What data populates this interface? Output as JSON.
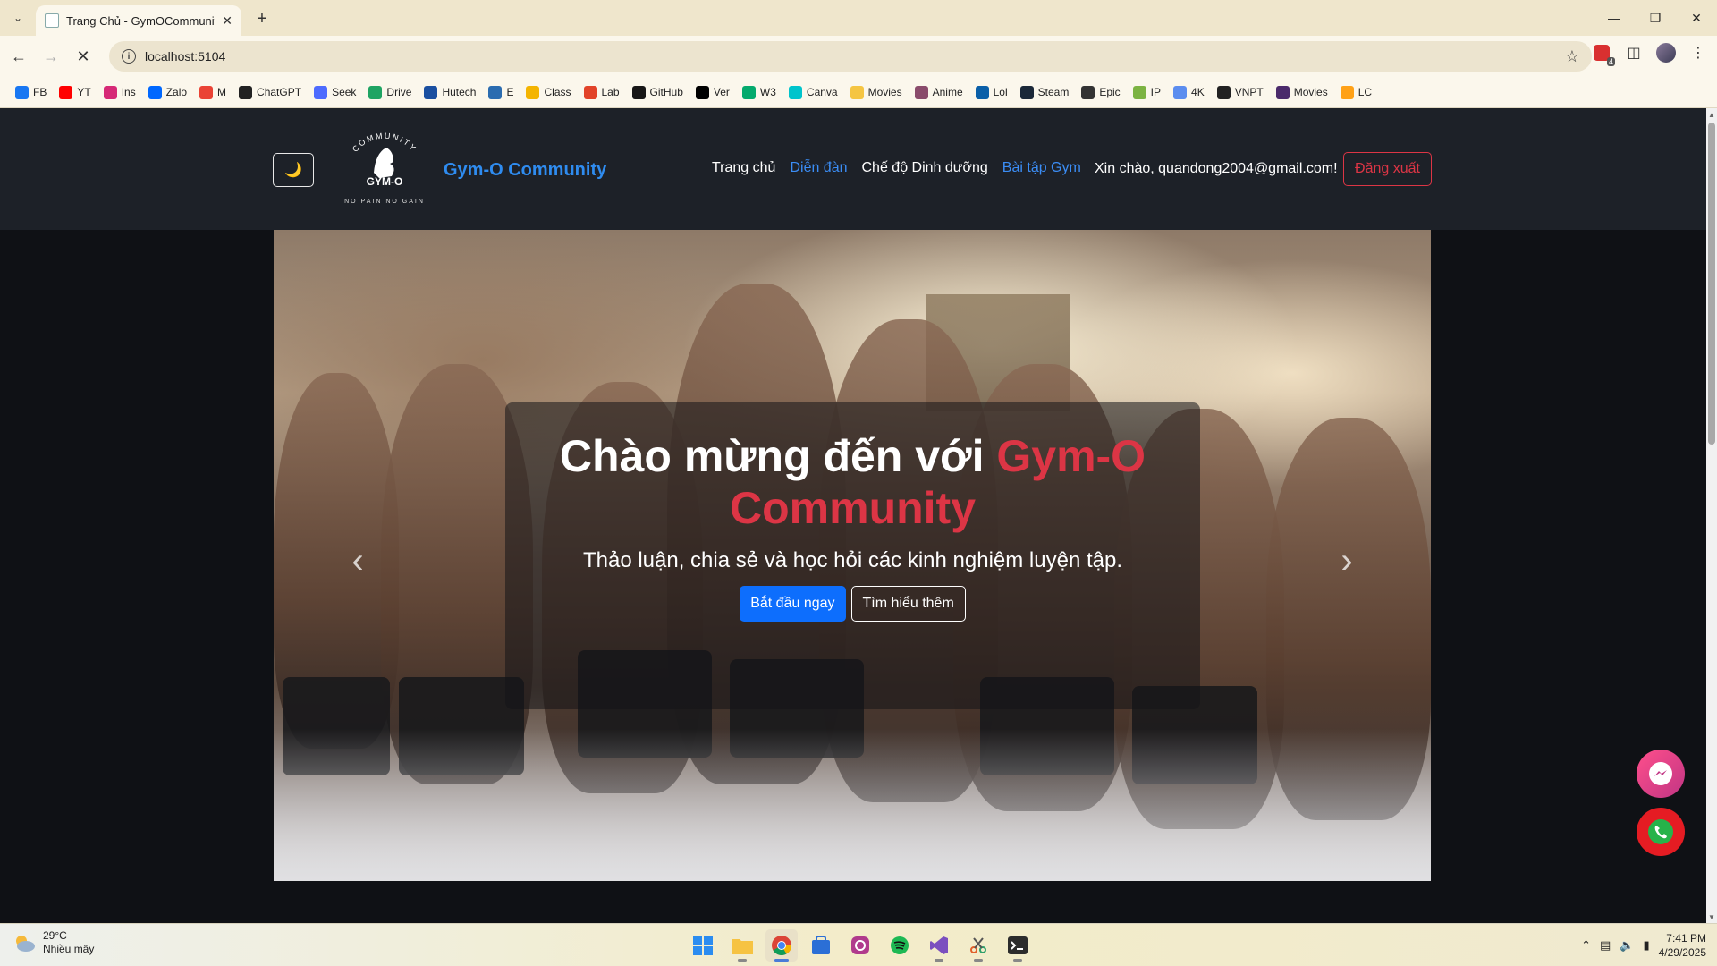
{
  "browser": {
    "tab_title": "Trang Chủ - GymOCommunity",
    "url": "localhost:5104",
    "bookmarks": [
      {
        "label": "FB",
        "color": "#1877f2"
      },
      {
        "label": "YT",
        "color": "#ff0000"
      },
      {
        "label": "Ins",
        "color": "#d62976"
      },
      {
        "label": "Zalo",
        "color": "#0068ff"
      },
      {
        "label": "M",
        "color": "#ea4335"
      },
      {
        "label": "ChatGPT",
        "color": "#222222"
      },
      {
        "label": "Seek",
        "color": "#4d6bfe"
      },
      {
        "label": "Drive",
        "color": "#1fa463"
      },
      {
        "label": "Hutech",
        "color": "#1a4fa0"
      },
      {
        "label": "E",
        "color": "#2b6cb0"
      },
      {
        "label": "Class",
        "color": "#f4b400"
      },
      {
        "label": "Lab",
        "color": "#e24329"
      },
      {
        "label": "GitHub",
        "color": "#181717"
      },
      {
        "label": "Ver",
        "color": "#000000"
      },
      {
        "label": "W3",
        "color": "#04aa6d"
      },
      {
        "label": "Canva",
        "color": "#00c4cc"
      },
      {
        "label": "Movies",
        "color": "#f5c542"
      },
      {
        "label": "Anime",
        "color": "#8a4b6b"
      },
      {
        "label": "Lol",
        "color": "#0a5fa8"
      },
      {
        "label": "Steam",
        "color": "#1b2838"
      },
      {
        "label": "Epic",
        "color": "#333333"
      },
      {
        "label": "IP",
        "color": "#7cb342"
      },
      {
        "label": "4K",
        "color": "#5b8def"
      },
      {
        "label": "VNPT",
        "color": "#222222"
      },
      {
        "label": "Movies",
        "color": "#4b2a6b"
      },
      {
        "label": "LC",
        "color": "#ffa116"
      }
    ]
  },
  "site": {
    "brand": "Gym-O Community",
    "logo_text": {
      "top": "COMMUNITY",
      "middle": "GYM-O",
      "bottom": "NO PAIN NO GAIN"
    },
    "nav": [
      {
        "label": "Trang chủ",
        "style": "white"
      },
      {
        "label": "Diễn đàn",
        "style": "blue"
      },
      {
        "label": "Chế độ Dinh dưỡng",
        "style": "white"
      },
      {
        "label": "Bài tập Gym",
        "style": "blue"
      }
    ],
    "greeting": "Xin chào, quandong2004@gmail.com!",
    "logout_label": "Đăng xuất",
    "theme_toggle_icon": "moon-icon"
  },
  "hero": {
    "title_prefix": "Chào mừng đến với ",
    "title_accent": "Gym-O Community",
    "subtitle": "Thảo luận, chia sẻ và học hỏi các kinh nghiệm luyện tập.",
    "primary_button": "Bắt đầu ngay",
    "secondary_button": "Tìm hiểu thêm",
    "slide_count": 3,
    "active_slide": 1,
    "accent_color": "#dc3545"
  },
  "taskbar": {
    "temperature": "29°C",
    "weather": "Nhiều mây",
    "time": "7:41 PM",
    "date": "4/29/2025"
  }
}
